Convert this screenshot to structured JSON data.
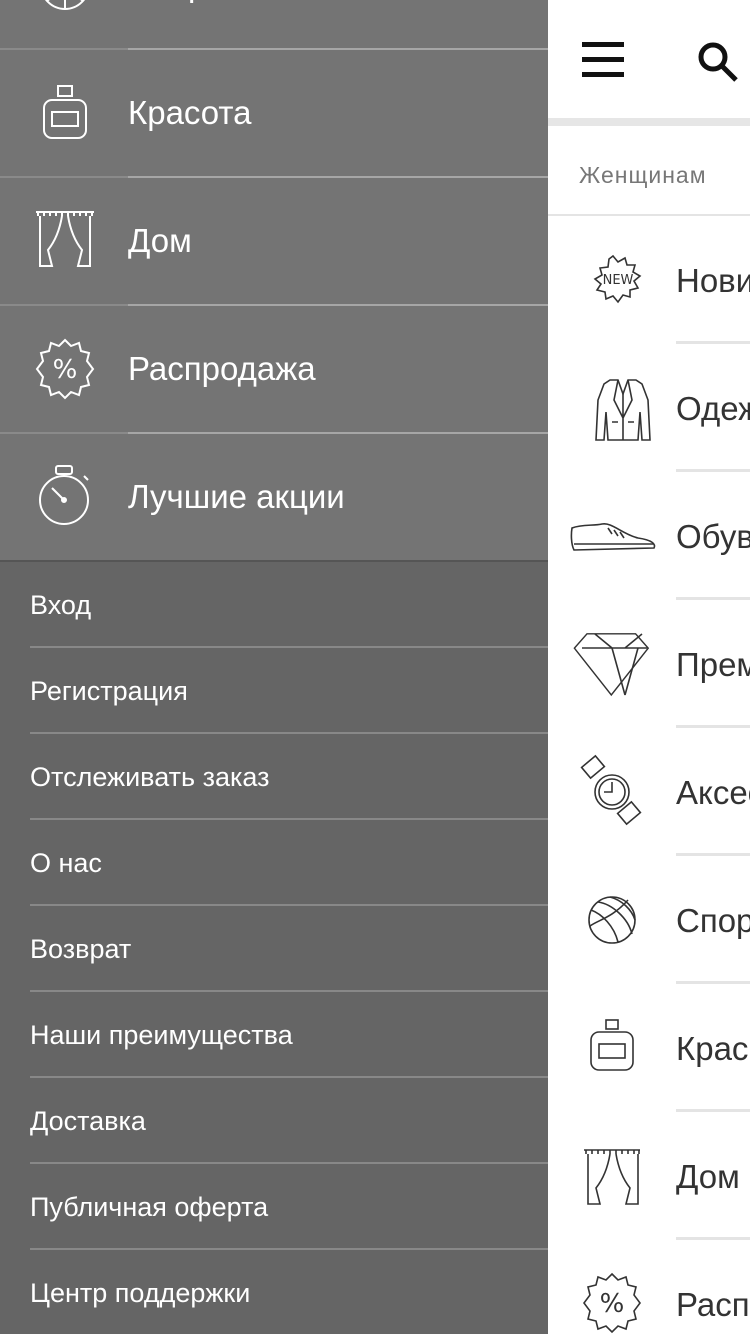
{
  "drawer": {
    "categories": [
      {
        "label": "Спорт",
        "icon": "ball-icon"
      },
      {
        "label": "Красота",
        "icon": "perfume-icon"
      },
      {
        "label": "Дом",
        "icon": "curtain-icon"
      },
      {
        "label": "Распродажа",
        "icon": "sale-badge-icon"
      },
      {
        "label": "Лучшие акции",
        "icon": "stopwatch-icon"
      }
    ],
    "links": [
      "Вход",
      "Регистрация",
      "Отслеживать заказ",
      "О нас",
      "Возврат",
      "Наши преимущества",
      "Доставка",
      "Публичная оферта",
      "Центр поддержки"
    ]
  },
  "main": {
    "breadcrumb": "Женщинам",
    "rows": [
      {
        "label": "Новинки",
        "icon": "new-badge-icon"
      },
      {
        "label": "Одежда",
        "icon": "jacket-icon"
      },
      {
        "label": "Обувь",
        "icon": "shoe-icon"
      },
      {
        "label": "Премиум",
        "icon": "diamond-icon"
      },
      {
        "label": "Аксессуары",
        "icon": "watch-icon"
      },
      {
        "label": "Спорт",
        "icon": "ball-icon"
      },
      {
        "label": "Красота",
        "icon": "perfume-icon"
      },
      {
        "label": "Дом",
        "icon": "curtain-icon"
      },
      {
        "label": "Распродажа",
        "icon": "sale-badge-icon"
      }
    ]
  },
  "colors": {
    "drawer_bg": "#6e6e6e",
    "category_bg": "#747474",
    "links_bg": "#656565",
    "main_bg": "#ffffff",
    "main_text": "#333333"
  }
}
